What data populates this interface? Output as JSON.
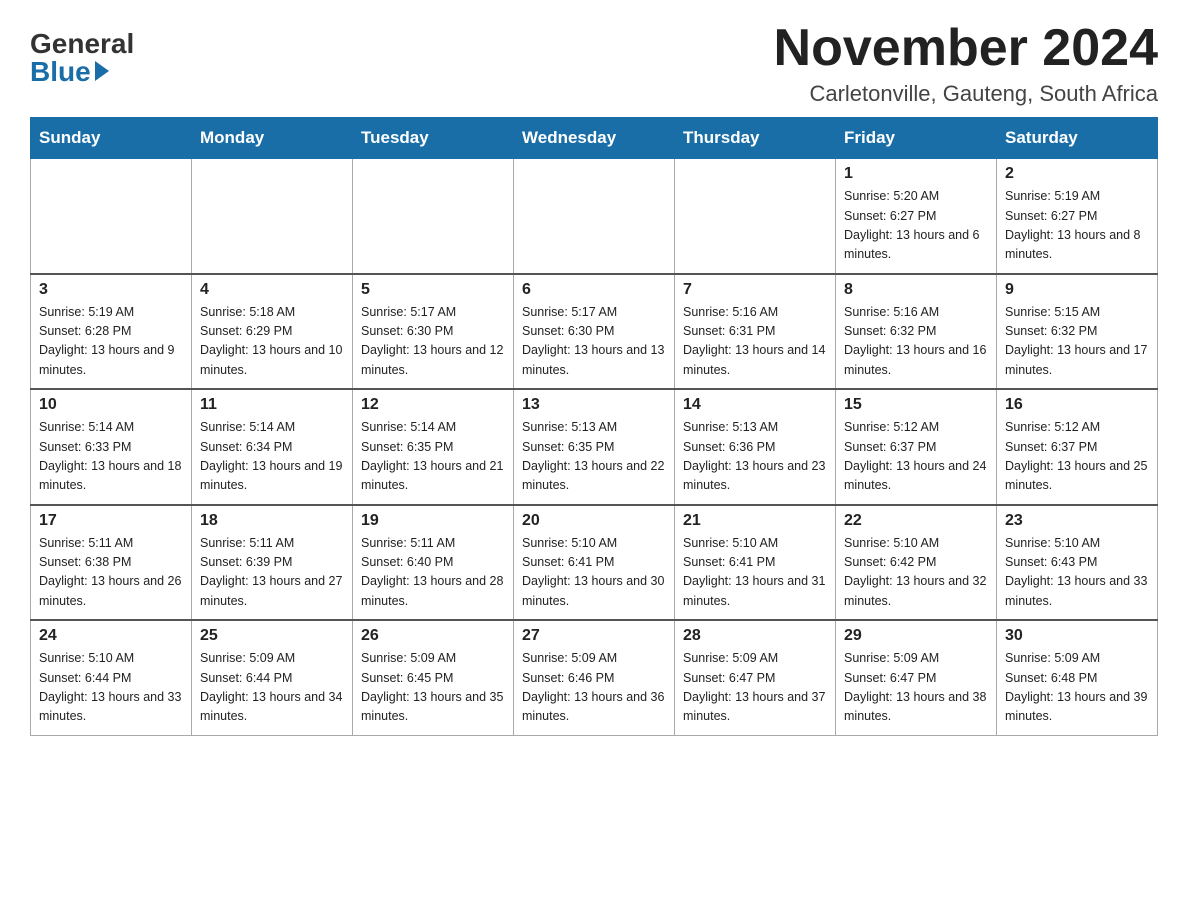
{
  "logo": {
    "general": "General",
    "blue": "Blue"
  },
  "header": {
    "month": "November 2024",
    "location": "Carletonville, Gauteng, South Africa"
  },
  "weekdays": [
    "Sunday",
    "Monday",
    "Tuesday",
    "Wednesday",
    "Thursday",
    "Friday",
    "Saturday"
  ],
  "weeks": [
    [
      {
        "day": "",
        "info": ""
      },
      {
        "day": "",
        "info": ""
      },
      {
        "day": "",
        "info": ""
      },
      {
        "day": "",
        "info": ""
      },
      {
        "day": "",
        "info": ""
      },
      {
        "day": "1",
        "info": "Sunrise: 5:20 AM\nSunset: 6:27 PM\nDaylight: 13 hours and 6 minutes."
      },
      {
        "day": "2",
        "info": "Sunrise: 5:19 AM\nSunset: 6:27 PM\nDaylight: 13 hours and 8 minutes."
      }
    ],
    [
      {
        "day": "3",
        "info": "Sunrise: 5:19 AM\nSunset: 6:28 PM\nDaylight: 13 hours and 9 minutes."
      },
      {
        "day": "4",
        "info": "Sunrise: 5:18 AM\nSunset: 6:29 PM\nDaylight: 13 hours and 10 minutes."
      },
      {
        "day": "5",
        "info": "Sunrise: 5:17 AM\nSunset: 6:30 PM\nDaylight: 13 hours and 12 minutes."
      },
      {
        "day": "6",
        "info": "Sunrise: 5:17 AM\nSunset: 6:30 PM\nDaylight: 13 hours and 13 minutes."
      },
      {
        "day": "7",
        "info": "Sunrise: 5:16 AM\nSunset: 6:31 PM\nDaylight: 13 hours and 14 minutes."
      },
      {
        "day": "8",
        "info": "Sunrise: 5:16 AM\nSunset: 6:32 PM\nDaylight: 13 hours and 16 minutes."
      },
      {
        "day": "9",
        "info": "Sunrise: 5:15 AM\nSunset: 6:32 PM\nDaylight: 13 hours and 17 minutes."
      }
    ],
    [
      {
        "day": "10",
        "info": "Sunrise: 5:14 AM\nSunset: 6:33 PM\nDaylight: 13 hours and 18 minutes."
      },
      {
        "day": "11",
        "info": "Sunrise: 5:14 AM\nSunset: 6:34 PM\nDaylight: 13 hours and 19 minutes."
      },
      {
        "day": "12",
        "info": "Sunrise: 5:14 AM\nSunset: 6:35 PM\nDaylight: 13 hours and 21 minutes."
      },
      {
        "day": "13",
        "info": "Sunrise: 5:13 AM\nSunset: 6:35 PM\nDaylight: 13 hours and 22 minutes."
      },
      {
        "day": "14",
        "info": "Sunrise: 5:13 AM\nSunset: 6:36 PM\nDaylight: 13 hours and 23 minutes."
      },
      {
        "day": "15",
        "info": "Sunrise: 5:12 AM\nSunset: 6:37 PM\nDaylight: 13 hours and 24 minutes."
      },
      {
        "day": "16",
        "info": "Sunrise: 5:12 AM\nSunset: 6:37 PM\nDaylight: 13 hours and 25 minutes."
      }
    ],
    [
      {
        "day": "17",
        "info": "Sunrise: 5:11 AM\nSunset: 6:38 PM\nDaylight: 13 hours and 26 minutes."
      },
      {
        "day": "18",
        "info": "Sunrise: 5:11 AM\nSunset: 6:39 PM\nDaylight: 13 hours and 27 minutes."
      },
      {
        "day": "19",
        "info": "Sunrise: 5:11 AM\nSunset: 6:40 PM\nDaylight: 13 hours and 28 minutes."
      },
      {
        "day": "20",
        "info": "Sunrise: 5:10 AM\nSunset: 6:41 PM\nDaylight: 13 hours and 30 minutes."
      },
      {
        "day": "21",
        "info": "Sunrise: 5:10 AM\nSunset: 6:41 PM\nDaylight: 13 hours and 31 minutes."
      },
      {
        "day": "22",
        "info": "Sunrise: 5:10 AM\nSunset: 6:42 PM\nDaylight: 13 hours and 32 minutes."
      },
      {
        "day": "23",
        "info": "Sunrise: 5:10 AM\nSunset: 6:43 PM\nDaylight: 13 hours and 33 minutes."
      }
    ],
    [
      {
        "day": "24",
        "info": "Sunrise: 5:10 AM\nSunset: 6:44 PM\nDaylight: 13 hours and 33 minutes."
      },
      {
        "day": "25",
        "info": "Sunrise: 5:09 AM\nSunset: 6:44 PM\nDaylight: 13 hours and 34 minutes."
      },
      {
        "day": "26",
        "info": "Sunrise: 5:09 AM\nSunset: 6:45 PM\nDaylight: 13 hours and 35 minutes."
      },
      {
        "day": "27",
        "info": "Sunrise: 5:09 AM\nSunset: 6:46 PM\nDaylight: 13 hours and 36 minutes."
      },
      {
        "day": "28",
        "info": "Sunrise: 5:09 AM\nSunset: 6:47 PM\nDaylight: 13 hours and 37 minutes."
      },
      {
        "day": "29",
        "info": "Sunrise: 5:09 AM\nSunset: 6:47 PM\nDaylight: 13 hours and 38 minutes."
      },
      {
        "day": "30",
        "info": "Sunrise: 5:09 AM\nSunset: 6:48 PM\nDaylight: 13 hours and 39 minutes."
      }
    ]
  ]
}
